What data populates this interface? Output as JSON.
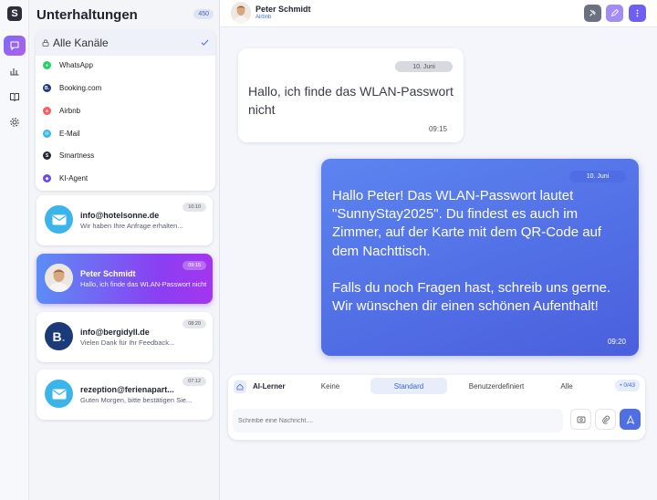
{
  "sidebar_title": "Unterhaltungen",
  "conversation_count": "450",
  "channels": {
    "selected": "Alle Kanäle",
    "items": [
      {
        "label": "WhatsApp",
        "color": "#25d366"
      },
      {
        "label": "Booking.com",
        "color": "#1f3c7a",
        "glyph": "B."
      },
      {
        "label": "Airbnb",
        "color": "#ff5a5f",
        "glyph": "a"
      },
      {
        "label": "E-Mail",
        "color": "#3bb7e8"
      },
      {
        "label": "Smartness",
        "color": "#252a36",
        "glyph": "S"
      },
      {
        "label": "KI-Agent",
        "color": "#6d49e8"
      }
    ]
  },
  "conversations": [
    {
      "name": "info@hotelsonne.de",
      "preview": "Wir haben Ihre Anfrage erhalten...",
      "time": "10:10",
      "avatar": "mail-icon",
      "avatar_color": "#3bb4ea",
      "active": false
    },
    {
      "name": "Peter Schmidt",
      "preview": "Hallo, ich finde das WLAN-Passwort nicht",
      "time": "09:15",
      "avatar": "person-photo",
      "avatar_color": "#d9c3a8",
      "active": true
    },
    {
      "name": "info@bergidyll.de",
      "preview": "Vielen Dank für Ihr Feedback...",
      "time": "08:20",
      "avatar": "booking-icon",
      "avatar_color": "#1c3a78",
      "active": false
    },
    {
      "name": "rezeption@ferienapart...",
      "preview": "Guten Morgen, bitte bestätigen Sie...",
      "time": "07:12",
      "avatar": "mail-icon",
      "avatar_color": "#3bb4ea",
      "active": false
    }
  ],
  "chat": {
    "contact_name": "Peter Schmidt",
    "contact_source": "Airbnb",
    "messages": [
      {
        "direction": "in",
        "date": "10. Juni",
        "text": "Hallo, ich finde das WLAN-Passwort nicht",
        "time": "09:15"
      },
      {
        "direction": "out",
        "date": "10. Juni",
        "text": "Hallo Peter! Das WLAN-Passwort lautet \"SunnyStay2025\". Du findest es auch im Zimmer, auf der Karte mit dem QR-Code auf dem Nachttisch.\n\nFalls du noch Fragen hast, schreib uns gerne. Wir wünschen dir einen schönen Aufenthalt!",
        "time": "09:20"
      }
    ]
  },
  "composer": {
    "ai_label": "AI-Lerner",
    "modes": [
      "Keine",
      "Standard",
      "Benutzerdefiniert",
      "Alle"
    ],
    "active_mode": "Standard",
    "counter": "• 0/43",
    "placeholder": "Schreibe eine Nachricht...."
  },
  "colors": {
    "accent": "#4f6fe3",
    "gradient_start": "#5b8df5",
    "gradient_end": "#a435ee"
  }
}
